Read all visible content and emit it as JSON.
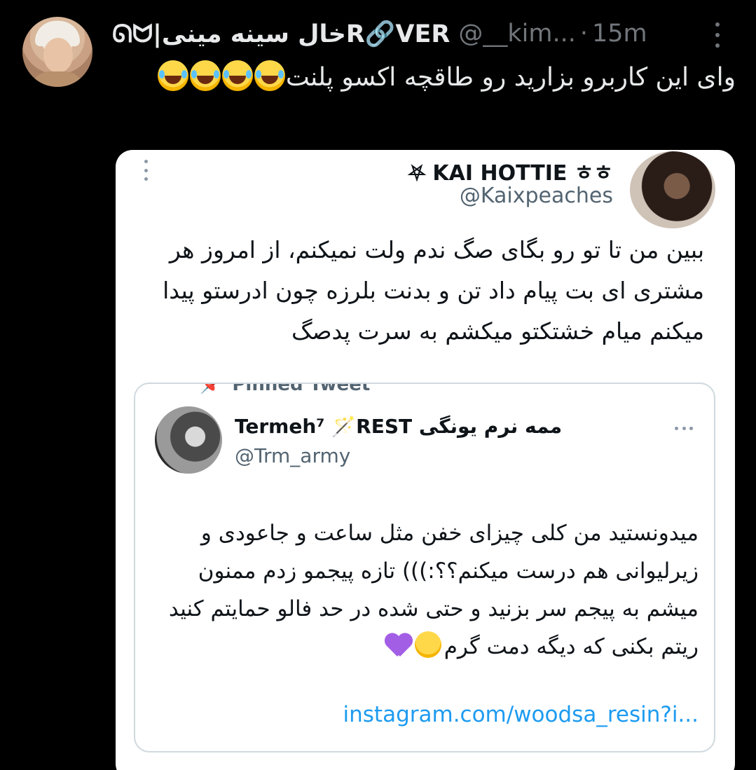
{
  "tweet": {
    "display_name": "ᘏᗢ|خال سینه مینیR🔗VER",
    "handle": "@__kim...",
    "separator": "·",
    "time": "15m",
    "text": "وای این کاربرو بزارید رو طاقچه اکسو پلنت",
    "emoji": "😂"
  },
  "quote": {
    "display_name": "⛧ KAI HOTTIE ㅎㅎ",
    "handle": "@Kaixpeaches",
    "text": "ببین من تا تو رو بگای صگ ندم ولت نمیکنم، از امروز هر مشتری ای بت پیام داد تن و بدنت بلرزه چون ادرستو پیدا میکنم میام خشتکتو میکشم به سرت پدصگ"
  },
  "pinned": {
    "label": "Pinned Tweet",
    "pin_glyph": "📌",
    "display_name": "Termeh⁷ 🪄REST ممه نرم یونگی",
    "handle": "@Trm_army",
    "text": "میدونستید من کلی چیزای خفن مثل ساعت و جاعودی و زیرلیوانی هم درست میکنم؟؟:))) تازه پیجمو زدم ممنون میشم به پیجم سر بزنید و حتی شده در حد فالو حمایتم کنید",
    "text_last": "ریتم بکنی که دیگه دمت گرم",
    "link": "instagram.com/woodsa_resin?i..."
  }
}
